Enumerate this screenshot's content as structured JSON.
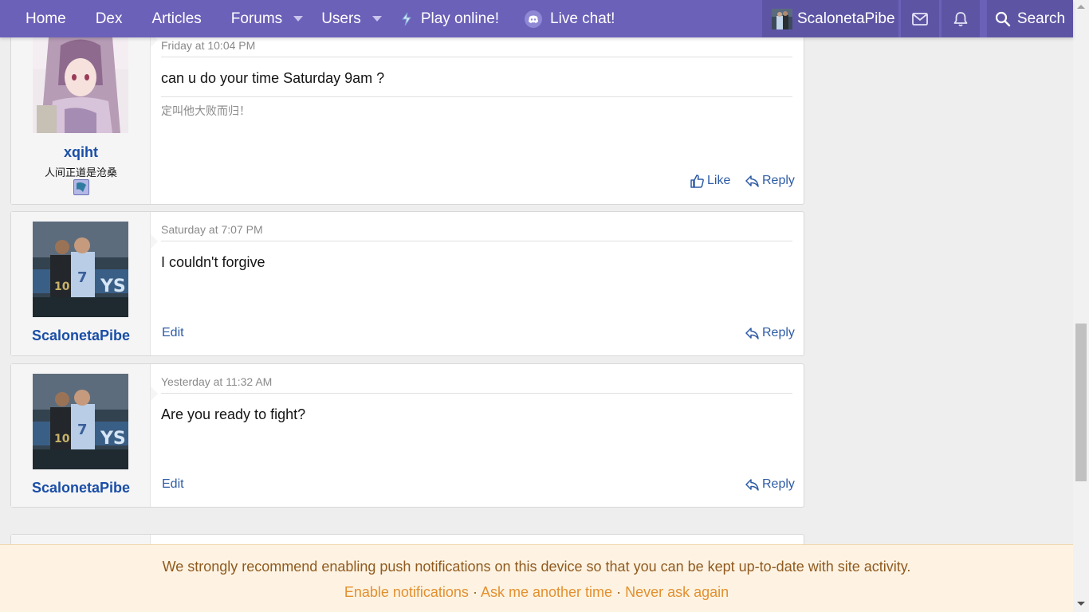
{
  "nav": {
    "home": "Home",
    "dex": "Dex",
    "articles": "Articles",
    "forums": "Forums",
    "users": "Users",
    "play_online": "Play online!",
    "live_chat": "Live chat!",
    "account_name": "ScalonetaPibe",
    "search": "Search",
    "bg_color": "#6b61b8"
  },
  "messages": [
    {
      "username": "xqiht",
      "user_title": "人间正道是沧桑",
      "date": "Friday at 10:04 PM",
      "content": "can u do your time Saturday 9am ?",
      "signature": "定叫他大败而归！",
      "like_label": "Like",
      "reply_label": "Reply"
    },
    {
      "username": "ScalonetaPibe",
      "date": "Saturday at 7:07 PM",
      "content": "I couldn't forgive",
      "edit_label": "Edit",
      "reply_label": "Reply"
    },
    {
      "username": "ScalonetaPibe",
      "date": "Yesterday at 11:32 AM",
      "content": "Are you ready to fight?",
      "edit_label": "Edit",
      "reply_label": "Reply"
    }
  ],
  "notice": {
    "text": "We strongly recommend enabling push notifications on this device so that you can be kept up-to-date with site activity.",
    "enable": "Enable notifications",
    "ask_later": "Ask me another time",
    "never": "Never ask again",
    "separator": "·"
  }
}
